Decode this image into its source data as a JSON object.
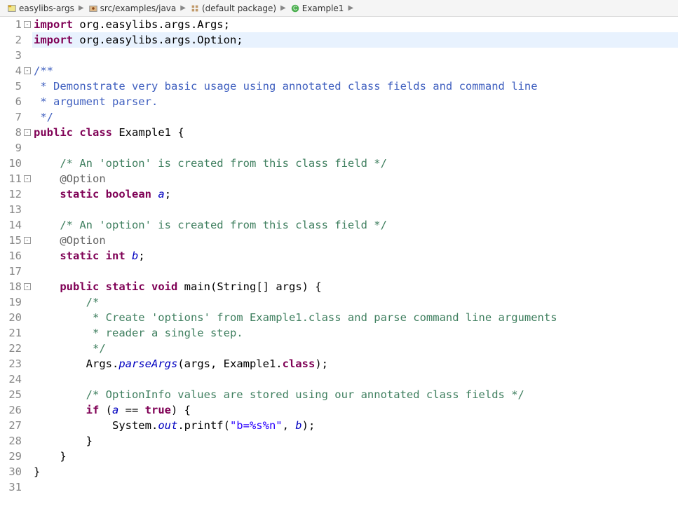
{
  "breadcrumb": {
    "items": [
      {
        "label": "easylibs-args",
        "icon": "project"
      },
      {
        "label": "src/examples/java",
        "icon": "package-folder"
      },
      {
        "label": "(default package)",
        "icon": "package"
      },
      {
        "label": "Example1",
        "icon": "class"
      },
      {
        "label": "",
        "icon": "none"
      }
    ]
  },
  "code": {
    "l1": {
      "kw1": "import",
      "pkg": " org.easylibs.args.Args;"
    },
    "l2": {
      "kw1": "import",
      "pkg": " org.easylibs.args.Option;"
    },
    "l4": {
      "doc": "/**"
    },
    "l5": {
      "doc": " * Demonstrate very basic usage using annotated class fields and command line"
    },
    "l6": {
      "doc": " * argument parser."
    },
    "l7": {
      "doc": " */"
    },
    "l8": {
      "kw1": "public",
      "kw2": "class",
      "name": " Example1 {"
    },
    "l10": {
      "cm": "    /* An 'option' is created from this class field */"
    },
    "l11": {
      "ann": "    @Option"
    },
    "l12": {
      "pad": "    ",
      "kw1": "static",
      "kw2": "boolean",
      "fld": "a",
      "end": ";"
    },
    "l14": {
      "cm": "    /* An 'option' is created from this class field */"
    },
    "l15": {
      "ann": "    @Option"
    },
    "l16": {
      "pad": "    ",
      "kw1": "static",
      "kw2": "int",
      "fld": "b",
      "end": ";"
    },
    "l18": {
      "pad": "    ",
      "kw1": "public",
      "kw2": "static",
      "kw3": "void",
      "name": " main(String[] args) {"
    },
    "l19": {
      "cm": "        /*"
    },
    "l20": {
      "cm": "         * Create 'options' from Example1.class and parse command line arguments"
    },
    "l21": {
      "cm": "         * reader a single step."
    },
    "l22": {
      "cm": "         */"
    },
    "l23": {
      "pad": "        Args.",
      "mth": "parseArgs",
      "mid": "(args, Example1.",
      "kw": "class",
      "end": ");"
    },
    "l25": {
      "cm": "        /* OptionInfo values are stored using our annotated class fields */"
    },
    "l26": {
      "pad": "        ",
      "kw1": "if",
      "mid": " (",
      "fld": "a",
      "mid2": " == ",
      "kw2": "true",
      "end": ") {"
    },
    "l27": {
      "pad": "            System.",
      "stat": "out",
      "mid": ".printf(",
      "str": "\"b=%s%n\"",
      "mid2": ", ",
      "fld": "b",
      "end": ");"
    },
    "l28": {
      "txt": "        }"
    },
    "l29": {
      "txt": "    }"
    },
    "l30": {
      "txt": "}"
    }
  },
  "lines": [
    "1",
    "2",
    "3",
    "4",
    "5",
    "6",
    "7",
    "8",
    "9",
    "10",
    "11",
    "12",
    "13",
    "14",
    "15",
    "16",
    "17",
    "18",
    "19",
    "20",
    "21",
    "22",
    "23",
    "24",
    "25",
    "26",
    "27",
    "28",
    "29",
    "30",
    "31"
  ]
}
